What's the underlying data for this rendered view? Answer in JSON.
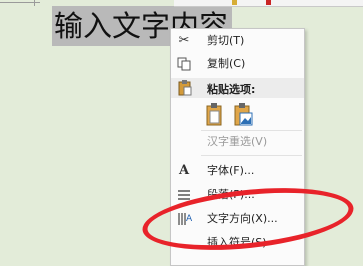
{
  "document": {
    "selected_text": "输入文字内容"
  },
  "context_menu": {
    "items": [
      {
        "label": "剪切(T)",
        "icon": "scissors-icon"
      },
      {
        "label": "复制(C)",
        "icon": "copy-icon"
      },
      {
        "label": "粘贴选项:",
        "icon": "clipboard-icon"
      },
      {
        "label": "汉字重选(V)"
      },
      {
        "label": "字体(F)...",
        "icon": "font-icon"
      },
      {
        "label": "段落(P)...",
        "icon": "paragraph-icon"
      },
      {
        "label": "文字方向(X)...",
        "icon": "text-direction-icon"
      },
      {
        "label": "插入符号(S)"
      }
    ],
    "paste_options": [
      "keep-source-formatting-icon",
      "picture-icon"
    ]
  },
  "annotation": {
    "color": "#e8232a",
    "shape": "ellipse"
  }
}
